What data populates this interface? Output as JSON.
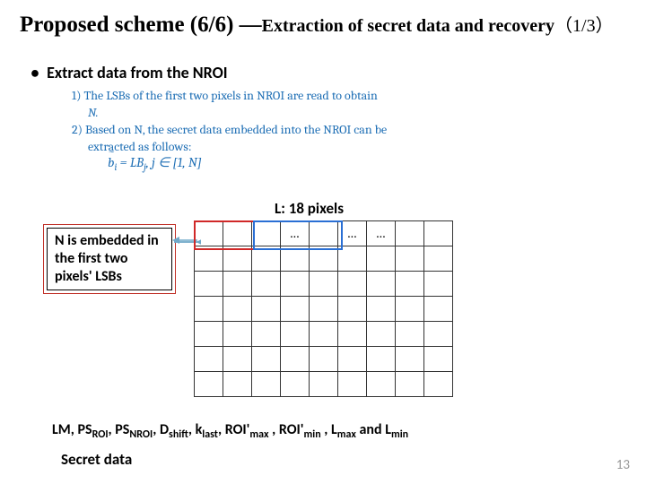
{
  "title": {
    "main": "Proposed scheme (6/6) —",
    "sub": "Extraction of secret data and recovery",
    "frac": "（1/3）"
  },
  "bullet": "Extract data from the NROI",
  "steps": {
    "line1a": "1)  The LSBs of the first two pixels in NROI are read to obtain",
    "line1b": "N.",
    "line2a": "2)  Based on N, the secret data embedded into the NROI can be",
    "line2b": "extracted as follows:"
  },
  "eq_html": "<span class=\"tilde\">b</span><sub>i</sub> = LB<sub>j</sub>, j ∈ [1, N]",
  "labels": {
    "L": "L: 18 pixels",
    "Nbox": "N is embedded in the first two pixels' LSBs",
    "cell_dots": "…",
    "cell_dots2": "…",
    "cell_dots3": "…"
  },
  "extracted_html": "LM, PS<sub>ROI</sub>, PS<sub>NROI</sub>, D<sub>shift</sub>, k<sub>last</sub>, ROI'<sub>max</sub>&nbsp;, ROI'<sub>min</sub>&nbsp;, L<sub>max</sub> and L<sub>min</sub>",
  "secret": "Secret data",
  "page": "13"
}
